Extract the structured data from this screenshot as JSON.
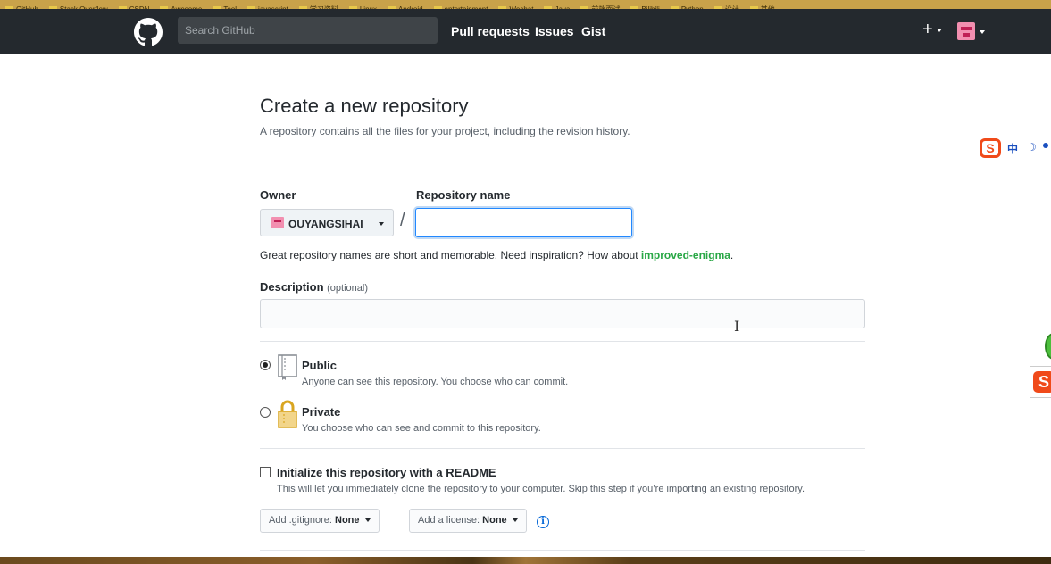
{
  "browser": {
    "bookmarks": [
      "GitHub",
      "Stack Overflow",
      "CSDN",
      "Awesome",
      "Tool",
      "javascript",
      "学习资料",
      "Linux",
      "Android",
      "entertainment",
      "Wechat",
      "Java",
      "前端面试",
      "Bilibili",
      "Python",
      "设计",
      "其他"
    ]
  },
  "header": {
    "search_placeholder": "Search GitHub",
    "nav": [
      "Pull requests",
      "Issues",
      "Gist"
    ],
    "plus": "+"
  },
  "page": {
    "title": "Create a new repository",
    "subtitle": "A repository contains all the files for your project, including the revision history."
  },
  "form": {
    "owner_label": "Owner",
    "owner_value": "OUYANGSIHAI",
    "repo_label": "Repository name",
    "repo_value": "",
    "slash": "/",
    "hint_prefix": "Great repository names are short and memorable. Need inspiration? How about ",
    "hint_suggestion": "improved-enigma",
    "hint_suffix": ".",
    "description_label": "Description",
    "description_optional": "(optional)",
    "description_value": "",
    "visibility": [
      {
        "title": "Public",
        "desc": "Anyone can see this repository. You choose who can commit.",
        "checked": true
      },
      {
        "title": "Private",
        "desc": "You choose who can see and commit to this repository.",
        "checked": false
      }
    ],
    "readme_title": "Initialize this repository with a README",
    "readme_desc": "This will let you immediately clone the repository to your computer. Skip this step if you’re importing an existing repository.",
    "readme_checked": false,
    "gitignore_label": "Add .gitignore:",
    "gitignore_value": "None",
    "license_label": "Add a license:",
    "license_value": "None",
    "info_icon": "i"
  },
  "ime": {
    "logo": "S",
    "mode": "中",
    "moon": "☽"
  },
  "colors": {
    "header_bg": "#24292e",
    "suggestion": "#28a745",
    "focus": "#2188ff",
    "link": "#0366d6"
  },
  "icons": [
    "github-logo-icon",
    "plus-icon",
    "repo-icon",
    "lock-icon",
    "info-icon",
    "ibeam-cursor-icon"
  ]
}
